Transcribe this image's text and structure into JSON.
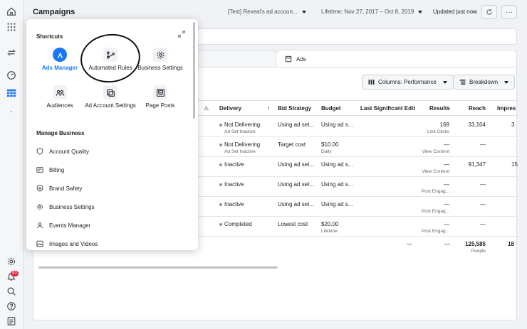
{
  "header": {
    "title": "Campaigns",
    "account": "[Test] Reveal's ad accoun...",
    "date_range": "Lifetime: Nov 27, 2017 – Oct 8, 2019",
    "updated": "Updated just now",
    "more": "···"
  },
  "tabs": {
    "ads_label": "Ads"
  },
  "toolbar": {
    "columns_label": "Columns: Performance",
    "breakdown_label": "Breakdown"
  },
  "table": {
    "columns": {
      "delivery": "Delivery",
      "bid_strategy": "Bid Strategy",
      "budget": "Budget",
      "last_edit": "Last Significant Edit",
      "results": "Results",
      "reach": "Reach",
      "impressions": "Impres"
    },
    "rows": [
      {
        "delivery": "Not Delivering",
        "delivery_sub": "Ad Set Inactive",
        "bid": "Using ad set...",
        "budget": "Using ad s...",
        "budget_sub": "",
        "results": "169",
        "results_sub": "Link Clicks",
        "reach": "33,104",
        "impr": "3"
      },
      {
        "delivery": "Not Delivering",
        "delivery_sub": "Ad Set Inactive",
        "bid": "Target cost",
        "budget": "$10.00",
        "budget_sub": "Daily",
        "results": "—",
        "results_sub": "View Content",
        "reach": "—",
        "impr": ""
      },
      {
        "delivery": "Inactive",
        "delivery_sub": "",
        "bid": "Using ad set...",
        "budget": "Using ad s...",
        "budget_sub": "",
        "results": "—",
        "results_sub": "View Content",
        "reach": "91,347",
        "impr": "15"
      },
      {
        "delivery": "Inactive",
        "delivery_sub": "",
        "bid": "Using ad set...",
        "budget": "Using ad s...",
        "budget_sub": "",
        "results": "—",
        "results_sub": "Post Engag...",
        "reach": "—",
        "impr": ""
      },
      {
        "delivery": "Inactive",
        "delivery_sub": "",
        "bid": "Using ad set...",
        "budget": "Using ad s...",
        "budget_sub": "",
        "results": "—",
        "results_sub": "Post Engag...",
        "reach": "—",
        "impr": ""
      },
      {
        "delivery": "Completed",
        "delivery_sub": "",
        "bid": "Lowest cost",
        "budget": "$20.00",
        "budget_sub": "Lifetime",
        "results": "—",
        "results_sub": "Post Engag...",
        "reach": "—",
        "impr": ""
      }
    ],
    "totals": {
      "last_edit": "—",
      "results": "—",
      "reach": "125,585",
      "reach_sub": "People",
      "impr": "18"
    }
  },
  "shortcuts": {
    "title": "Shortcuts",
    "items": [
      {
        "label": "Ads Manager"
      },
      {
        "label": "Automated Rules"
      },
      {
        "label": "Business Settings"
      },
      {
        "label": "Audiences"
      },
      {
        "label": "Ad Account Settings"
      },
      {
        "label": "Page Posts"
      }
    ],
    "manage_title": "Manage Business",
    "manage_items": [
      {
        "label": "Account Quality"
      },
      {
        "label": "Billing"
      },
      {
        "label": "Brand Safety"
      },
      {
        "label": "Business Settings"
      },
      {
        "label": "Events Manager"
      },
      {
        "label": "Images and Videos"
      }
    ]
  },
  "notifications": {
    "count": "93"
  },
  "colors": {
    "accent": "#1877f2",
    "badge": "#e41e3f"
  }
}
